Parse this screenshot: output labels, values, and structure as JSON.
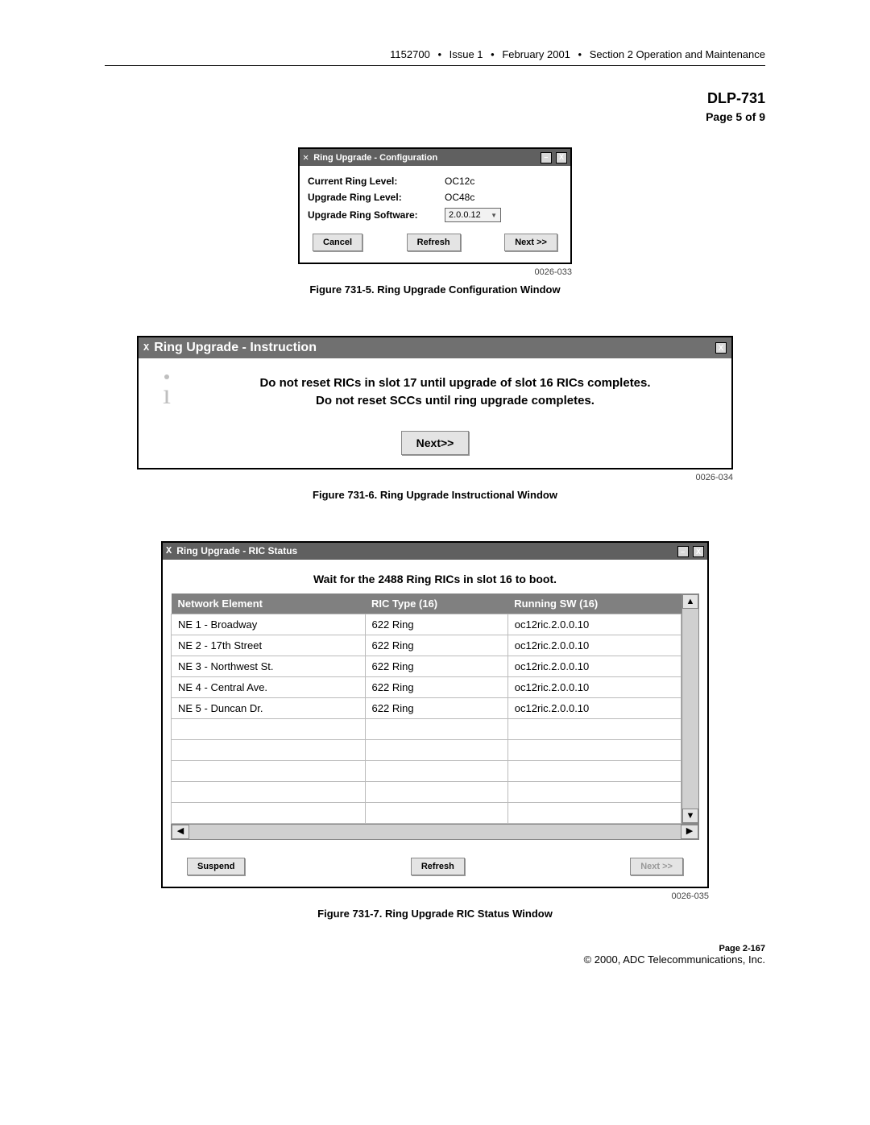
{
  "header": {
    "docnum": "1152700",
    "issue": "Issue 1",
    "date": "February 2001",
    "section": "Section 2 Operation and Maintenance"
  },
  "title": "DLP-731",
  "page_of": "Page 5 of 9",
  "config_dlg": {
    "title": "Ring Upgrade - Configuration",
    "rows": {
      "current_lbl": "Current Ring Level:",
      "current_val": "OC12c",
      "upgrade_lbl": "Upgrade Ring Level:",
      "upgrade_val": "OC48c",
      "software_lbl": "Upgrade Ring Software:",
      "software_val": "2.0.0.12"
    },
    "buttons": {
      "cancel": "Cancel",
      "refresh": "Refresh",
      "next": "Next >>"
    },
    "fig_id": "0026-033",
    "caption": "Figure 731-5. Ring Upgrade Configuration Window"
  },
  "instr_dlg": {
    "title": "Ring Upgrade - Instruction",
    "line1": "Do not reset RICs in slot 17 until upgrade of slot 16 RICs completes.",
    "line2": "Do not reset SCCs until ring upgrade completes.",
    "next": "Next>>",
    "fig_id": "0026-034",
    "caption": "Figure 731-6. Ring Upgrade Instructional Window"
  },
  "ric_dlg": {
    "title": "Ring Upgrade - RIC Status",
    "wait": "Wait for the 2488 Ring RICs in slot 16 to boot.",
    "cols": {
      "ne": "Network Element",
      "type": "RIC Type (16)",
      "sw": "Running SW (16)"
    },
    "rows": [
      {
        "ne": "NE 1 - Broadway",
        "type": "622 Ring",
        "sw": "oc12ric.2.0.0.10"
      },
      {
        "ne": "NE 2 - 17th Street",
        "type": "622 Ring",
        "sw": "oc12ric.2.0.0.10"
      },
      {
        "ne": "NE 3 - Northwest St.",
        "type": "622 Ring",
        "sw": "oc12ric.2.0.0.10"
      },
      {
        "ne": "NE 4 - Central Ave.",
        "type": "622 Ring",
        "sw": "oc12ric.2.0.0.10"
      },
      {
        "ne": "NE 5 - Duncan Dr.",
        "type": "622 Ring",
        "sw": "oc12ric.2.0.0.10"
      }
    ],
    "buttons": {
      "suspend": "Suspend",
      "refresh": "Refresh",
      "next": "Next >>"
    },
    "fig_id": "0026-035",
    "caption": "Figure 731-7. Ring Upgrade RIC Status Window"
  },
  "footer": {
    "page": "Page 2-167",
    "copy": "© 2000, ADC Telecommunications, Inc."
  },
  "glyph": {
    "bullet": "•",
    "x": "X",
    "tri_down": "▼",
    "up": "▲",
    "left": "◀",
    "right": "▶",
    "min": "–"
  }
}
